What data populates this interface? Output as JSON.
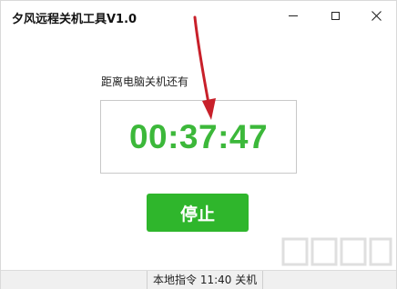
{
  "window": {
    "title": "夕风远程关机工具V1.0"
  },
  "main": {
    "prompt": "距离电脑关机还有",
    "countdown": "00:37:47",
    "stop_label": "停止"
  },
  "statusbar": {
    "text": "本地指令 11:40 关机"
  },
  "colors": {
    "timer": "#3cb83a",
    "button": "#2fb62c",
    "arrow": "#c8202a"
  },
  "icons": {
    "minimize": "minimize-icon",
    "maximize": "maximize-icon",
    "close": "close-icon"
  }
}
